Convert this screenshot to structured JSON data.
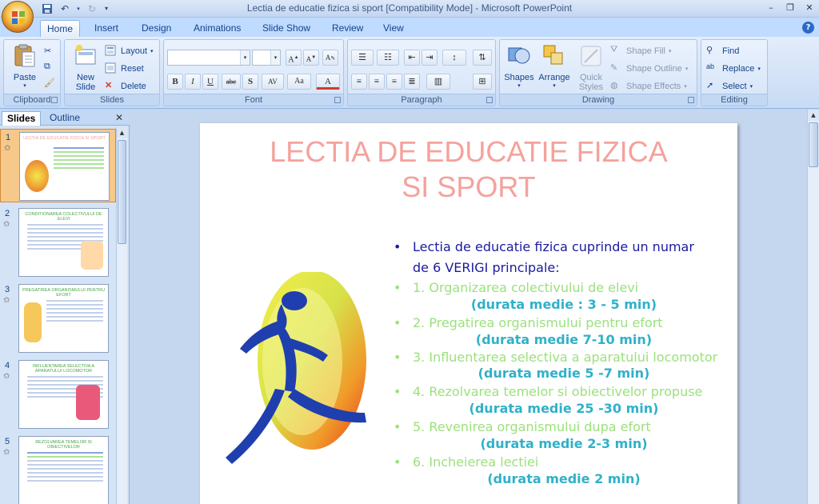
{
  "window": {
    "title": "Lectia de educatie fizica si sport [Compatibility Mode] - Microsoft PowerPoint"
  },
  "ribbon": {
    "tabs": [
      "Home",
      "Insert",
      "Design",
      "Animations",
      "Slide Show",
      "Review",
      "View"
    ],
    "active_tab": "Home",
    "groups": {
      "clipboard": {
        "label": "Clipboard",
        "paste": "Paste"
      },
      "slides": {
        "label": "Slides",
        "new_slide_line1": "New",
        "new_slide_line2": "Slide",
        "layout": "Layout",
        "reset": "Reset",
        "delete": "Delete"
      },
      "font": {
        "label": "Font",
        "bold": "B",
        "italic": "I",
        "underline": "U",
        "strike": "abc",
        "shadow": "S",
        "spacing": "AV",
        "case": "Aa"
      },
      "paragraph": {
        "label": "Paragraph"
      },
      "drawing": {
        "label": "Drawing",
        "shapes": "Shapes",
        "arrange": "Arrange",
        "quick_styles_line1": "Quick",
        "quick_styles_line2": "Styles",
        "shape_fill": "Shape Fill",
        "shape_outline": "Shape Outline",
        "shape_effects": "Shape Effects"
      },
      "editing": {
        "label": "Editing",
        "find": "Find",
        "replace": "Replace",
        "select": "Select"
      }
    }
  },
  "left_pane": {
    "tabs": [
      "Slides",
      "Outline"
    ],
    "active_tab": "Slides",
    "thumbnails": [
      {
        "number": "1",
        "title": "LECTIA DE EDUCATIE FIZICA SI SPORT"
      },
      {
        "number": "2",
        "title": "CONDITIONAREA COLECTIVULUI DE ELEVI"
      },
      {
        "number": "3",
        "title": "PREGATIREA ORGANISMULUI PENTRU EFORT"
      },
      {
        "number": "4",
        "title": "INFLUENTAREA SELECTIVA A APARATULUI LOCOMOTOR"
      },
      {
        "number": "5",
        "title": "REZOLVAREA TEMELOR SI OBIECTIVELOR"
      }
    ]
  },
  "slide": {
    "title_line1": "LECTIA DE EDUCATIE FIZICA",
    "title_line2": "SI SPORT",
    "intro_line1": "Lectia de educatie fizica cuprinde un numar",
    "intro_line2": "de   6 VERIGI principale:",
    "items": [
      {
        "text": "1. Organizarea  colectivului  de  elevi",
        "duration": "(durata medie  :  3  -  5  min)"
      },
      {
        "text": "2. Pregatirea  organismului  pentru  efort",
        "duration": "(durata medie 7-10 min)"
      },
      {
        "text": "3. Influentarea selectiva a aparatului locomotor",
        "duration": "(durata medie 5  -7 min)"
      },
      {
        "text": "4. Rezolvarea temelor si obiectivelor propuse",
        "duration": "(durata medie 25  -30 min)"
      },
      {
        "text": "5. Revenirea organismului dupa efort",
        "duration": "(durata medie 2-3 min)"
      },
      {
        "text": "6. Incheierea lectiei",
        "duration": "(durata medie 2 min)"
      }
    ]
  },
  "colors": {
    "title_pink": "#f4a29c",
    "intro_navy": "#1b1b9e",
    "item_green": "#9be17c",
    "duration_teal": "#2fb1c8"
  }
}
